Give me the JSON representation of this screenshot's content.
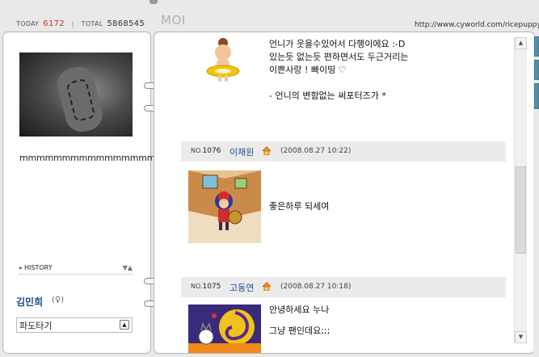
{
  "header": {
    "today_label": "TODAY",
    "today_count": "6172",
    "total_label": "TOTAL",
    "total_count": "5868545",
    "title": "MOI",
    "url": "http://www.cyworld.com/ricepuppy"
  },
  "profile": {
    "mood_text": "mmmmmmmmmmmmmmmm",
    "history_label": "HISTORY",
    "owner_name": "김민희",
    "gender_symbol": "(♀)",
    "dropdown_value": "파도타기",
    "photo_icon": "profile-photo"
  },
  "guestbook": {
    "first_entry_lines": [
      "언니가 웃을수있어서 다행이에요 :-D",
      "있는듯 없는듯 편하면서도 두근거리는",
      "이쁜사랑 ! 빠이띵 ♡",
      "",
      "- 언니의 변함없는 써포터즈가  *"
    ],
    "entries": [
      {
        "no_label": "NO.",
        "no": "1076",
        "name": "이채원",
        "date": "(2008.08.27 10:22)",
        "message": "좋은하루 되세여"
      },
      {
        "no_label": "NO.",
        "no": "1075",
        "name": "고동연",
        "date": "(2008.08.27 10:18)",
        "message_lines": [
          "안녕하세요 누나",
          "",
          "그냥 팬인데요;;;"
        ]
      }
    ]
  },
  "colors": {
    "accent_blue": "#1e4f8c",
    "today_red": "#d52b2b",
    "bar_gray": "#ebebeb",
    "right_tab": "#4f93ad"
  },
  "icons": [
    "home-icon",
    "scroll-up-icon",
    "scroll-down-icon",
    "history-arrow-icon",
    "dropdown-icon"
  ]
}
